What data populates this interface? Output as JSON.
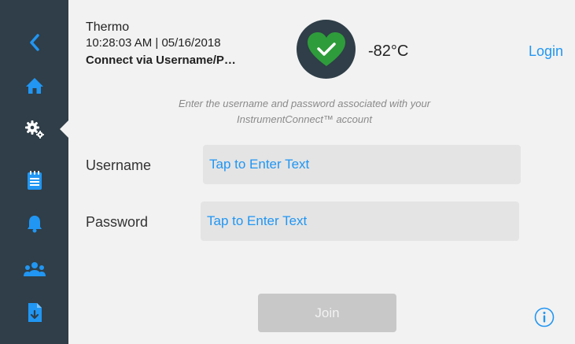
{
  "header": {
    "name": "Thermo",
    "datetime": "10:28:03 AM | 05/16/2018",
    "subtitle": "Connect via Username/P…",
    "temperature": "-82°C",
    "login_label": "Login"
  },
  "sidebar": {
    "items": [
      {
        "icon": "back-chevron-icon"
      },
      {
        "icon": "home-icon"
      },
      {
        "icon": "settings-gears-icon",
        "selected": true
      },
      {
        "icon": "clipboard-icon"
      },
      {
        "icon": "bell-icon"
      },
      {
        "icon": "users-icon"
      },
      {
        "icon": "file-download-icon"
      }
    ]
  },
  "form": {
    "instructions_line1": "Enter the username and password associated with your",
    "instructions_line2": "InstrumentConnect™ account",
    "username_label": "Username",
    "username_placeholder": "Tap to Enter Text",
    "password_label": "Password",
    "password_placeholder": "Tap to Enter Text",
    "join_label": "Join"
  },
  "colors": {
    "sidebar": "#2f3e48",
    "accent": "#2196f3",
    "status_ok": "#2e9c3a",
    "background": "#f2f2f2",
    "disabled": "#c8c8c8"
  }
}
